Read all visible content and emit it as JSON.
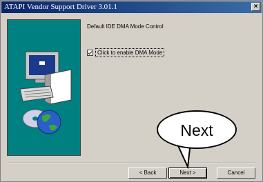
{
  "window": {
    "title": "ATAPI Vendor Support Driver 3.01.1",
    "close_label": "×"
  },
  "content": {
    "heading": "Default IDE DMA Mode Control",
    "checkbox_label": "Click to enable DMA Mode",
    "checkbox_checked": true
  },
  "buttons": {
    "back": "< Back",
    "next": "Next >",
    "cancel": "Cancel"
  },
  "callout": {
    "text": "Next"
  },
  "colors": {
    "titlebar": "#0a246a",
    "panel": "#008080",
    "window": "#d4d0c8"
  },
  "icons": [
    "computer-icon",
    "cd-disc-icon",
    "globe-icon"
  ]
}
